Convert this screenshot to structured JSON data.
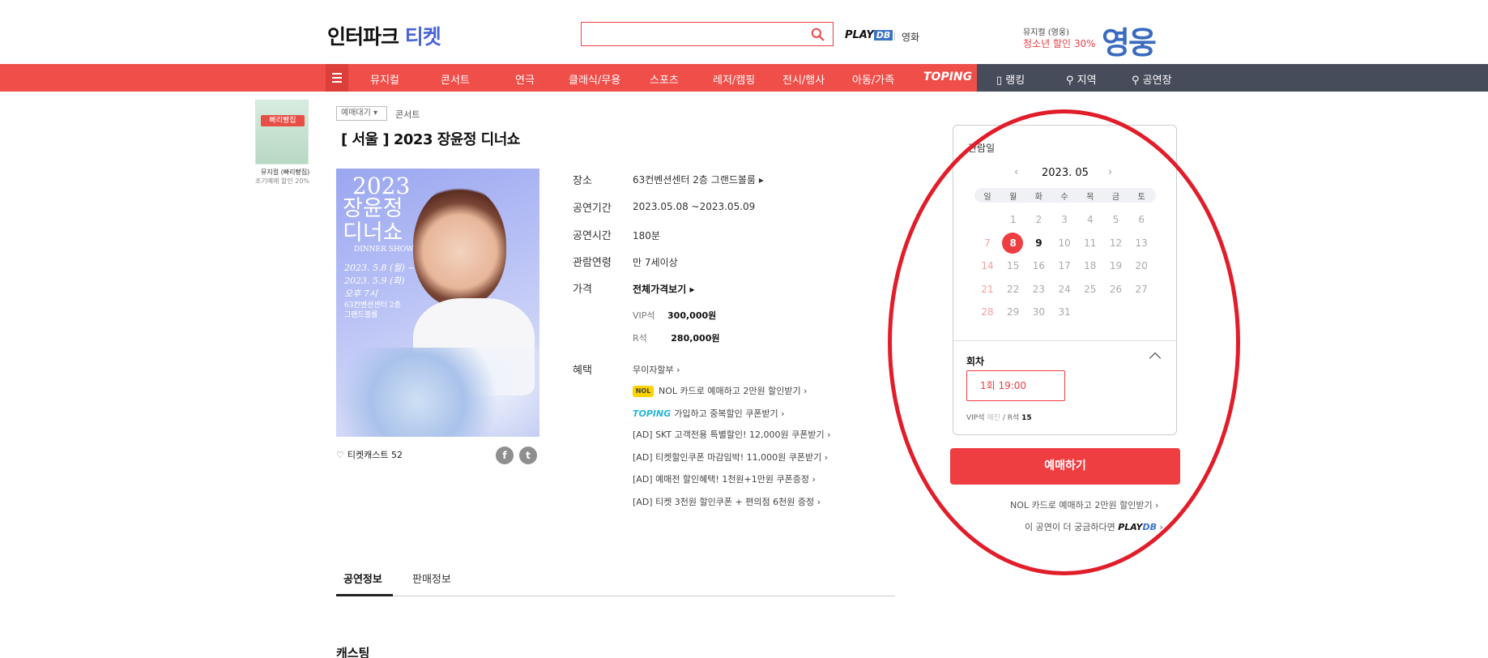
{
  "header": {
    "logo_main": "인터파크",
    "logo_accent": "티켓",
    "search_placeholder": "",
    "playdb_text": "PLAY",
    "playdb_box": "DB",
    "movie_link": "영화",
    "promo_line1": "뮤지컬 (영웅)",
    "promo_line2": "청소년 할인 30%",
    "promo_logo": "영웅"
  },
  "nav": {
    "items": [
      "뮤지컬",
      "콘서트",
      "연극",
      "클래식/무용",
      "스포츠",
      "레저/캠핑",
      "전시/행사",
      "아동/가족"
    ],
    "toping": "TOPING",
    "right_items": [
      "랭킹",
      "지역",
      "공연장"
    ]
  },
  "side_ad": {
    "thumb_title": "빠리빵집",
    "caption1": "뮤지컬 (빠리빵집)",
    "caption2": "조기예매 할인 20%"
  },
  "product": {
    "status_tag": "예매대기",
    "genre": "콘서트",
    "title": "[ 서울 ]  2023 장윤정 디너쇼",
    "poster": {
      "year": "2023",
      "name_line1": "장윤정",
      "name_line2": "디너쇼",
      "subtitle": "DINNER SHOW",
      "date1": "2023. 5.8 (월) ~",
      "date2": "2023. 5.9 (화)",
      "time": "오후 7시",
      "venue1": "63컨벤션센터 2층",
      "venue2": "그랜드볼룸"
    },
    "likes_label": "티켓캐스트",
    "likes_count": "52",
    "sns": [
      "f",
      "t"
    ],
    "info": {
      "venue_label": "장소",
      "venue": "63컨벤션센터 2층 그랜드볼룸",
      "period_label": "공연기간",
      "period": "2023.05.08 ~2023.05.09",
      "duration_label": "공연시간",
      "duration": "180분",
      "age_label": "관람연령",
      "age": "만 7세이상",
      "price_label": "가격",
      "price_all": "전체가격보기",
      "prices": [
        {
          "grade": "VIP석",
          "amount": "300,000원"
        },
        {
          "grade": "R석",
          "amount": "280,000원"
        }
      ],
      "benefit_label": "혜택",
      "benefits": [
        "무이자할부",
        "NOL 카드로 예매하고 2만원 할인받기",
        "가입하고 중복할인 쿠폰받기",
        "[AD] SKT 고객전용 특별할인! 12,000원 쿠폰받기",
        "[AD] 티켓할인쿠폰 마감임박! 11,000원 쿠폰받기",
        "[AD] 예매전 할인혜택! 1천원+1만원 쿠폰증정",
        "[AD] 티켓 3천원 할인쿠폰 + 편의점 6천원 증정"
      ],
      "nol_badge": "NOL",
      "toping_badge": "TOPING"
    }
  },
  "tabs": {
    "items": [
      "공연정보",
      "판매정보"
    ],
    "active": "공연정보"
  },
  "section": {
    "title": "캐스팅"
  },
  "booking": {
    "panel_title": "관람일",
    "month": "2023. 05",
    "prev_arrow": "‹",
    "next_arrow": "›",
    "weekdays": [
      "일",
      "월",
      "화",
      "수",
      "목",
      "금",
      "토"
    ],
    "weeks": [
      [
        "",
        "1",
        "2",
        "3",
        "4",
        "5",
        "6"
      ],
      [
        "7",
        "8",
        "9",
        "10",
        "11",
        "12",
        "13"
      ],
      [
        "14",
        "15",
        "16",
        "17",
        "18",
        "19",
        "20"
      ],
      [
        "21",
        "22",
        "23",
        "24",
        "25",
        "26",
        "27"
      ],
      [
        "28",
        "29",
        "30",
        "31",
        "",
        "",
        ""
      ]
    ],
    "selected_day": "8",
    "available_days": [
      "9"
    ],
    "round_label": "회차",
    "round_option": "1회 19:00",
    "seat_vip": "VIP석",
    "seat_vip_status": "매진",
    "seat_r": "R석",
    "seat_r_count": "15",
    "book_button": "예매하기",
    "nol_link": "NOL 카드로 예매하고 2만원 할인받기",
    "more_text": "이 공연이 더 궁금하다면",
    "more_brand": "PLAY",
    "more_brand_accent": "DB"
  },
  "colors": {
    "brand_red": "#ef4e49",
    "accent_red": "#ef3e42",
    "nav_dark": "#474c5b",
    "logo_blue": "#4a63d6",
    "annotation_red": "#e21d2a"
  }
}
